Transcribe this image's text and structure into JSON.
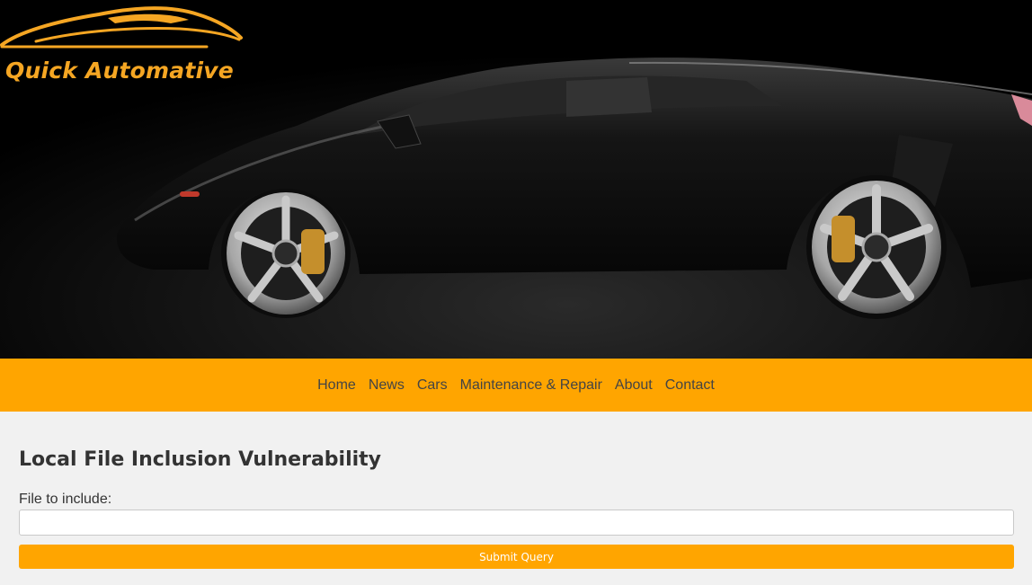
{
  "brand": {
    "name": "Quick Automative",
    "accent_color": "#ffa500"
  },
  "nav": {
    "items": [
      {
        "label": "Home"
      },
      {
        "label": "News"
      },
      {
        "label": "Cars"
      },
      {
        "label": "Maintenance & Repair"
      },
      {
        "label": "About"
      },
      {
        "label": "Contact"
      }
    ]
  },
  "main": {
    "title": "Local File Inclusion Vulnerability",
    "file_label": "File to include:",
    "file_value": "",
    "submit_label": "Submit Query"
  }
}
